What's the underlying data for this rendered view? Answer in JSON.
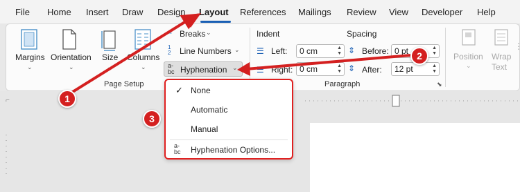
{
  "menubar": {
    "items": [
      "File",
      "Home",
      "Insert",
      "Draw",
      "Design",
      "Layout",
      "References",
      "Mailings",
      "Review",
      "View",
      "Developer",
      "Help"
    ],
    "active": "Layout"
  },
  "ribbon": {
    "page_setup": {
      "margins": "Margins",
      "orientation": "Orientation",
      "size": "Size",
      "columns": "Columns",
      "breaks": "Breaks",
      "line_numbers": "Line Numbers",
      "hyphenation": "Hyphenation",
      "group_label": "Page Setup"
    },
    "paragraph": {
      "indent_title": "Indent",
      "spacing_title": "Spacing",
      "left_label": "Left:",
      "left_value": "0 cm",
      "right_label": "Right:",
      "right_value": "0 cm",
      "before_label": "Before:",
      "before_value": "0 pt",
      "after_label": "After:",
      "after_value": "12 pt",
      "group_label": "Paragraph"
    },
    "arrange": {
      "position": "Position",
      "wrap_text_1": "Wrap",
      "wrap_text_2": "Text"
    }
  },
  "hyphenation_menu": {
    "none": "None",
    "automatic": "Automatic",
    "manual": "Manual",
    "options": "Hyphenation Options...",
    "selected": "None"
  },
  "callouts": [
    "1",
    "2",
    "3"
  ],
  "colors": {
    "callout_red": "#d42020",
    "accent_blue": "#1a5fb4"
  }
}
